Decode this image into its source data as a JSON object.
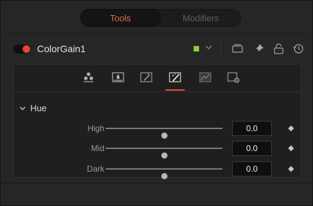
{
  "tabs": [
    {
      "label": "Tools",
      "active": true
    },
    {
      "label": "Modifiers",
      "active": false
    }
  ],
  "node": {
    "name": "ColorGain1",
    "enabled": true,
    "swatch_color": "#8fce3a"
  },
  "header_icons": [
    "view-icon",
    "pin-icon",
    "lock-icon",
    "reset-icon"
  ],
  "toolbar_icons": [
    "gain-icon",
    "saturation-icon",
    "color-balance-icon",
    "hue-icon",
    "channels-icon",
    "settings-icon"
  ],
  "active_toolbar_index": 3,
  "group": {
    "label": "Hue",
    "expanded": true
  },
  "params": [
    {
      "label": "High",
      "value": "0.0",
      "slider": 0.5
    },
    {
      "label": "Mid",
      "value": "0.0",
      "slider": 0.5
    },
    {
      "label": "Dark",
      "value": "0.0",
      "slider": 0.5
    }
  ],
  "colors": {
    "accent": "#e2503a",
    "toggle_on": "#e8452d"
  }
}
